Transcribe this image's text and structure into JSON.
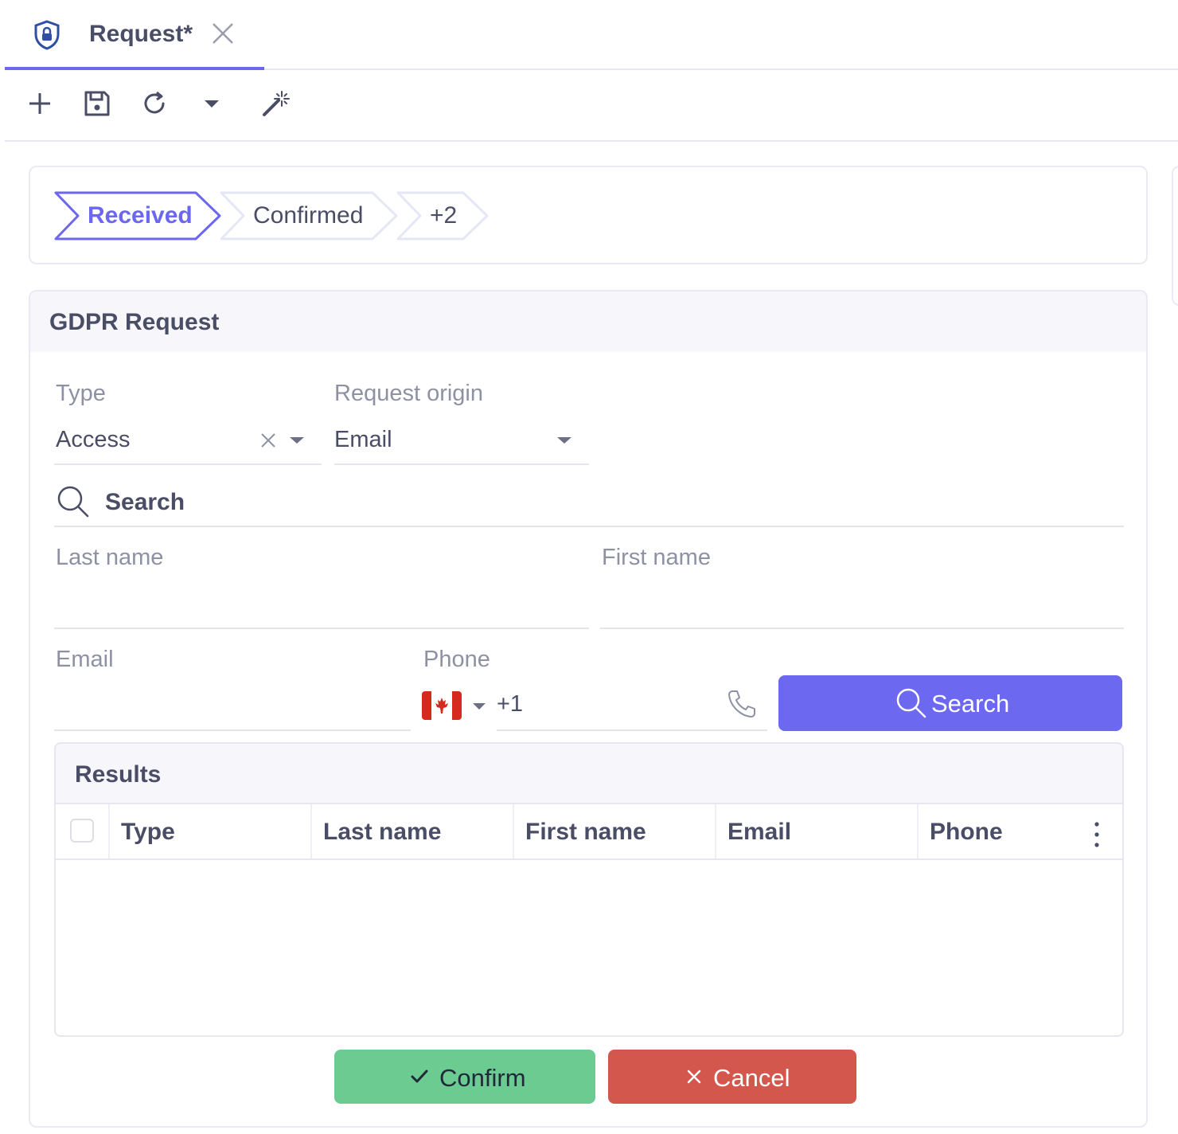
{
  "tab": {
    "title": "Request*"
  },
  "workflow": {
    "steps": [
      "Received",
      "Confirmed",
      "+2"
    ]
  },
  "form": {
    "title": "GDPR Request",
    "type": {
      "label": "Type",
      "value": "Access"
    },
    "origin": {
      "label": "Request origin",
      "value": "Email"
    },
    "search_section": {
      "title": "Search"
    },
    "last_name": {
      "label": "Last name",
      "value": ""
    },
    "first_name": {
      "label": "First name",
      "value": ""
    },
    "email": {
      "label": "Email",
      "value": ""
    },
    "phone": {
      "label": "Phone",
      "country_code": "+1",
      "flag": "canada-flag"
    },
    "search_button": "Search"
  },
  "results": {
    "title": "Results",
    "columns": [
      "Type",
      "Last name",
      "First name",
      "Email",
      "Phone"
    ],
    "rows": []
  },
  "actions": {
    "confirm": "Confirm",
    "cancel": "Cancel"
  },
  "colors": {
    "accent": "#6b67ef",
    "confirm": "#6ccb91",
    "cancel": "#d3574c"
  }
}
